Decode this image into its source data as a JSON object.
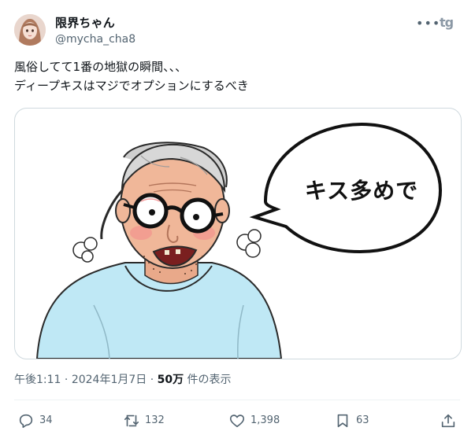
{
  "author": {
    "display_name": "限界ちゃん",
    "handle": "@mycha_cha8"
  },
  "menu": {
    "more_label": "•••"
  },
  "brand": {
    "logo_text": "tg"
  },
  "tweet": {
    "lines": [
      "風俗してて1番の地獄の瞬間、、、",
      "ディープキスはマジでオプションにするべき"
    ]
  },
  "media": {
    "speech_bubble": "キス多めで"
  },
  "meta": {
    "time": "午後1:11",
    "separator": " · ",
    "date": "2024年1月7日",
    "views_count": "50万",
    "views_label": " 件の表示"
  },
  "actions": {
    "replies": "34",
    "reposts": "132",
    "likes": "1,398",
    "bookmarks": "63"
  },
  "colors": {
    "text_primary": "#0f1419",
    "text_secondary": "#536471",
    "border": "#cfd9de",
    "shirt": "#bfe8f5"
  }
}
